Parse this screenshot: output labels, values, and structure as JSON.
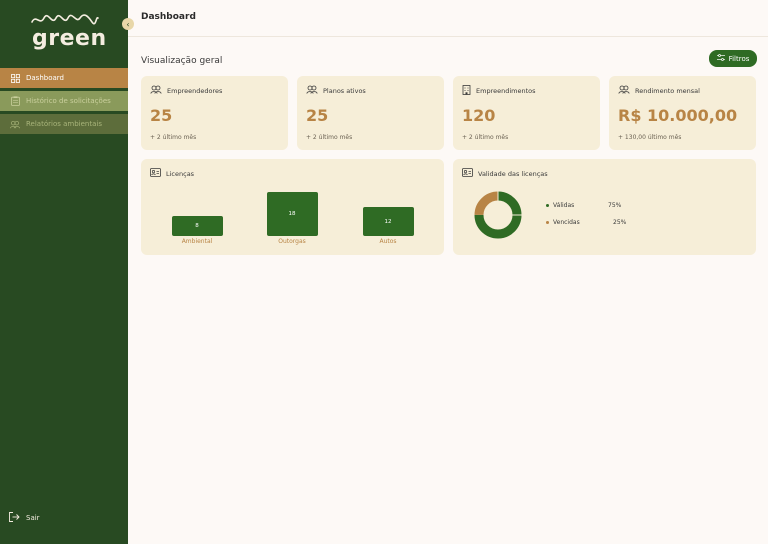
{
  "sidebar": {
    "logo_text": "green",
    "items": [
      {
        "label": "Dashboard"
      },
      {
        "label": "Histórico de solicitações"
      },
      {
        "label": "Relatórios ambientais"
      }
    ],
    "logout_label": "Sair"
  },
  "header": {
    "title": "Dashboard"
  },
  "overview": {
    "title": "Visualização geral",
    "filter_label": "Filtros"
  },
  "stats": [
    {
      "label": "Empreendedores",
      "value": "25",
      "sub": "+ 2 último mês",
      "icon": "users-icon"
    },
    {
      "label": "Planos ativos",
      "value": "25",
      "sub": "+ 2 último mês",
      "icon": "users-icon"
    },
    {
      "label": "Empreendimentos",
      "value": "120",
      "sub": "+ 2 último mês",
      "icon": "building-icon"
    },
    {
      "label": "Rendimento mensal",
      "value": "R$ 10.000,00",
      "sub": "+ 130,00 último mês",
      "icon": "users-icon"
    }
  ],
  "licenses": {
    "title": "Licenças",
    "bars": [
      {
        "label": "Ambiental",
        "value": "8"
      },
      {
        "label": "Outorgas",
        "value": "18"
      },
      {
        "label": "Autos",
        "value": "12"
      }
    ]
  },
  "validity": {
    "title": "Validade das licenças",
    "items": [
      {
        "label": "Válidas",
        "value": "75%",
        "color": "#2f6b24"
      },
      {
        "label": "Vencidas",
        "value": "25%",
        "color": "#b88445"
      }
    ]
  },
  "colors": {
    "sidebar": "#284a22",
    "accent": "#b88445",
    "primary": "#2f6b24",
    "card": "#f6eed8"
  },
  "chart_data": [
    {
      "type": "bar",
      "title": "Licenças",
      "categories": [
        "Ambiental",
        "Outorgas",
        "Autos"
      ],
      "values": [
        8,
        18,
        12
      ]
    },
    {
      "type": "pie",
      "title": "Validade das licenças",
      "categories": [
        "Válidas",
        "Vencidas"
      ],
      "values": [
        75,
        25
      ]
    }
  ]
}
